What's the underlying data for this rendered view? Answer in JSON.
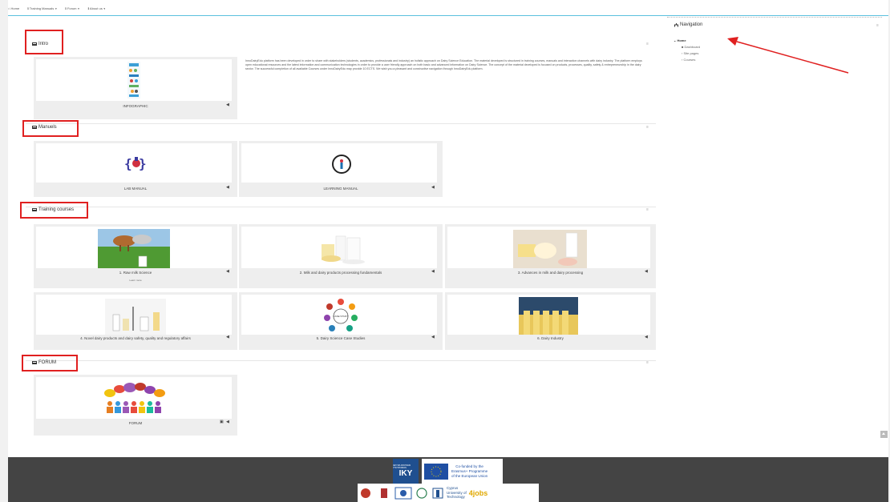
{
  "topnav": {
    "home": "Home",
    "training_manuals": "Training Manuals",
    "forum": "Forum",
    "about_us": "About us"
  },
  "sections": {
    "intro": "Intro",
    "manuals": "Manuels",
    "training": "Training courses",
    "forum": "FORUM"
  },
  "intro": {
    "infographic_label": "INFOGRAPHIC",
    "text": "InnoDairyEdu platform has been developed in order to share with stakeholders (students, academics, professionals and industry) an holistic approach on Dairy Science Education. The material developed is structured in training courses, manuals and interaction channels with dairy industry. The platform employs open educational resources and the latest information and communication technologies in order to provide a user friendly approach on both basic and advanced information on Dairy Science. The concept of the material developed is focused on products, processes, quality, safety & entrepreneurship in the dairy sector. The successful completion of all available Courses under InnoDairyEdu may provide 10 ECTS. We wish you a pleasant and constructive navigation through InnoDairyEdu platform."
  },
  "manuals": {
    "lab": "LAB MANUAL",
    "learning": "LEARNING MANUAL"
  },
  "courses": {
    "c1": "1. Raw milk Science",
    "c1_sub": "Learn more",
    "c2": "2. Milk and dairy products processing fundamentals",
    "c3": "3. Advances in milk and dairy processing",
    "c4": "4. Novel dairy products and dairy safety, quality and regulatory affairs",
    "c5": "5. Dairy Science Case Studies",
    "c6": "6. Dairy Industry",
    "case_study_badge": "CASE STUDY"
  },
  "forum": {
    "label": "FORUM"
  },
  "navigation": {
    "title": "Navigation",
    "home": "Home",
    "dashboard": "Dashboard",
    "site_pages": "Site pages",
    "courses": "Courses"
  },
  "footer": {
    "iky": "IKY",
    "iky_small": "ΙΔΡΥΜΑ ΚΡΑΤΙΚΩΝ ΥΠΟΤΡΟΦΙΩΝ",
    "erasmus": "Co-funded by the Erasmus+ Programme of the European Union",
    "erasmus_l1": "Co-funded by the",
    "erasmus_l2": "Erasmus+ Programme",
    "erasmus_l3": "of the European Union",
    "cyprus_l1": "Cyprus",
    "cyprus_l2": "University of",
    "cyprus_l3": "Technology",
    "jobs": "4jobs",
    "uni": "UNIVERSITY"
  },
  "colors": {
    "highlight": "#e02020",
    "accent": "#5bc0de",
    "footer": "#444444"
  }
}
